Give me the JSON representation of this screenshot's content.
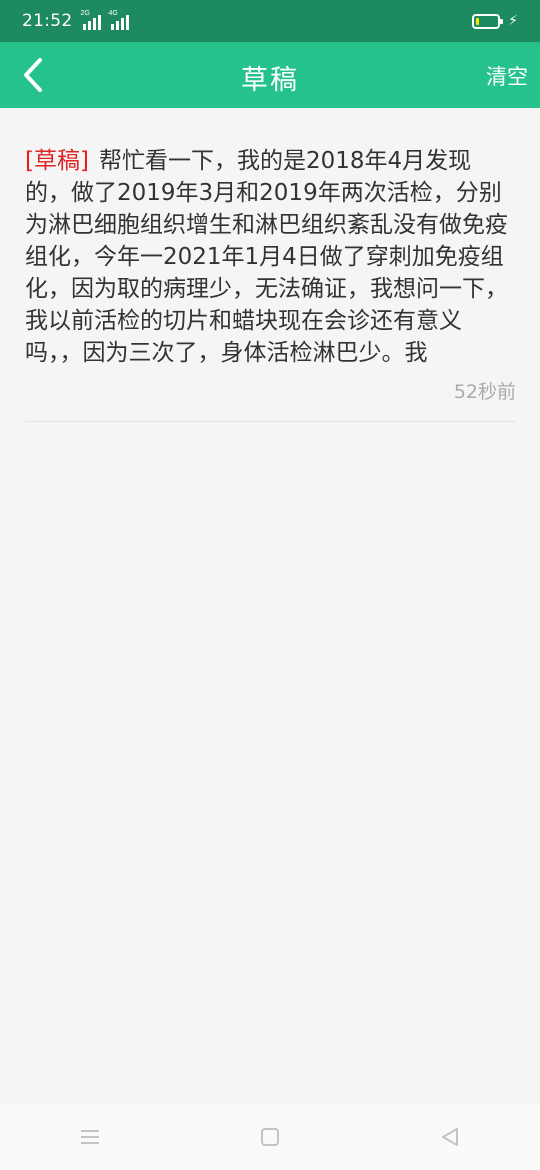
{
  "status_bar": {
    "time": "21:52",
    "network_1": "2G",
    "network_2": "4G",
    "battery_percent": 15
  },
  "header": {
    "title": "草稿",
    "clear_label": "清空"
  },
  "draft": {
    "tag": "[草稿]",
    "text": "帮忙看一下，我的是2018年4月发现的，做了2019年3月和2019年两次活检，分别为淋巴细胞组织增生和淋巴组织紊乱没有做免疫组化，今年一2021年1月4日做了穿刺加免疫组化，因为取的病理少，无法确证，我想问一下，我以前活检的切片和蜡块现在会诊还有意义吗，，因为三次了，身体活检淋巴少。我",
    "time": "52秒前"
  },
  "colors": {
    "header": "#25c38b",
    "status_bar": "#1e8a60",
    "tag": "#e02424"
  },
  "icons": [
    "back-arrow-icon",
    "menu-icon",
    "home-icon",
    "back-triangle-icon",
    "battery-icon",
    "bolt-icon"
  ]
}
